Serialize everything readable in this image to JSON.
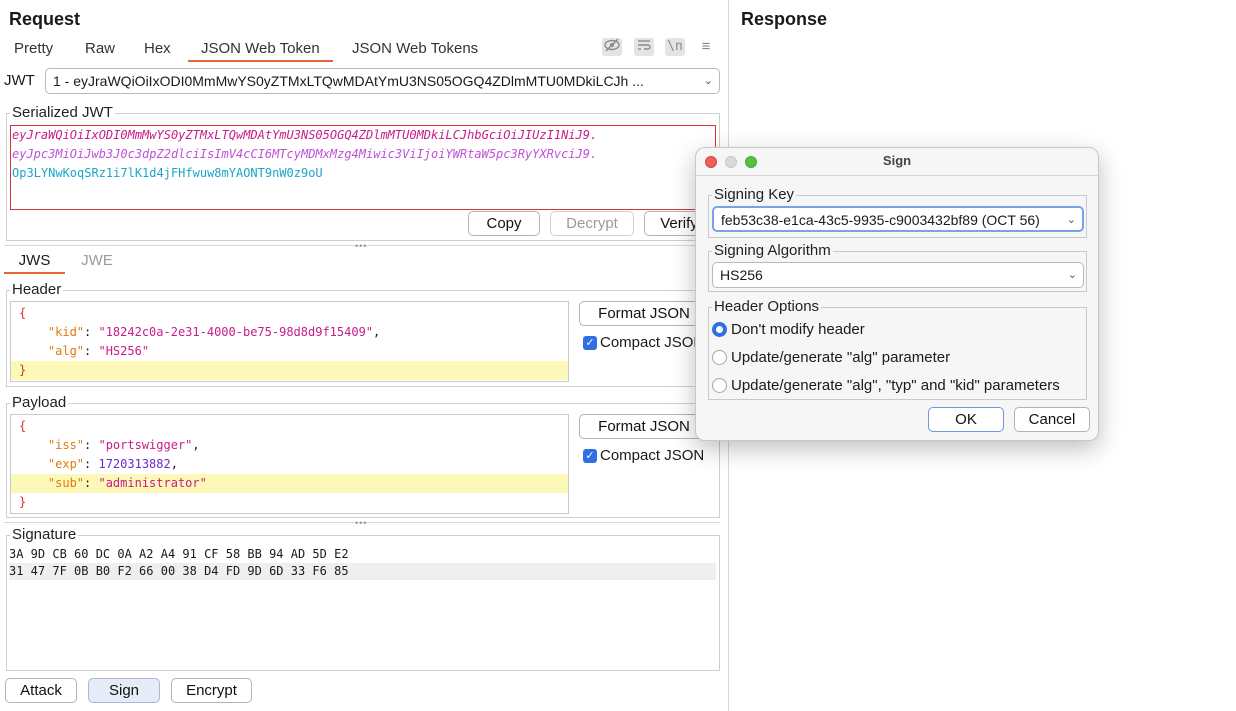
{
  "request": {
    "title": "Request",
    "tabs": [
      "Pretty",
      "Raw",
      "Hex",
      "JSON Web Token",
      "JSON Web Tokens"
    ],
    "active_tab": "JSON Web Token",
    "jwt_label": "JWT",
    "jwt_select_value": "1 - eyJraWQiOiIxODI0MmMwYS0yZTMxLTQwMDAtYmU3NS05OGQ4ZDlmMTU0MDkiLCJh ...",
    "serialized_label": "Serialized JWT",
    "serialized_parts": [
      "eyJraWQiOiIxODI0MmMwYS0yZTMxLTQwMDAtYmU3NS05OGQ4ZDlmMTU0MDkiLCJhbGciOiJIUzI1NiJ9.",
      "eyJpc3MiOiJwb3J0c3dpZ2dlciIsImV4cCI6MTcyMDMxMzg4Miwic3ViIjoiYWRtaW5pc3RyYXRvciJ9.",
      "Op3LYNwKoqSRz1i7lK1d4jFHfwuw8mYAONT9nW0z9oU"
    ],
    "buttons": {
      "copy": "Copy",
      "decrypt": "Decrypt",
      "verify": "Verify"
    },
    "sub_tabs": [
      "JWS",
      "JWE"
    ],
    "header": {
      "label": "Header",
      "kid_key": "\"kid\"",
      "kid_value": "\"18242c0a-2e31-4000-be75-98d8d9f15409\"",
      "alg_key": "\"alg\"",
      "alg_value": "\"HS256\"",
      "format_button": "Format JSON",
      "compact_label": "Compact JSON"
    },
    "payload": {
      "label": "Payload",
      "iss_key": "\"iss\"",
      "iss_value": "\"portswigger\"",
      "exp_key": "\"exp\"",
      "exp_value": "1720313882",
      "sub_key": "\"sub\"",
      "sub_value": "\"administrator\"",
      "format_button": "Format JSON",
      "compact_label": "Compact JSON"
    },
    "signature": {
      "label": "Signature",
      "lines": [
        "3A 9D CB 60 DC 0A A2 A4 91 CF 58 BB 94 AD 5D E2",
        "31 47 7F 0B B0 F2 66 00 38 D4 FD 9D 6D 33 F6 85"
      ]
    },
    "bottom_buttons": [
      "Attack",
      "Sign",
      "Encrypt"
    ]
  },
  "response": {
    "title": "Response"
  },
  "dialog": {
    "title": "Sign",
    "signing_key_label": "Signing Key",
    "signing_key_value": "feb53c38-e1ca-43c5-9935-c9003432bf89 (OCT 56)",
    "signing_algorithm_label": "Signing Algorithm",
    "signing_algorithm_value": "HS256",
    "header_options_label": "Header Options",
    "options": [
      "Don't modify header",
      "Update/generate \"alg\" parameter",
      "Update/generate \"alg\", \"typ\" and \"kid\" parameters"
    ],
    "selected_option": 0,
    "ok": "OK",
    "cancel": "Cancel"
  },
  "colors": {
    "accent": "#e8653a",
    "jwt_header": "#c81c8a",
    "jwt_payload": "#c050d8",
    "jwt_signature": "#1aa6c8",
    "error_border": "#d9333a"
  }
}
